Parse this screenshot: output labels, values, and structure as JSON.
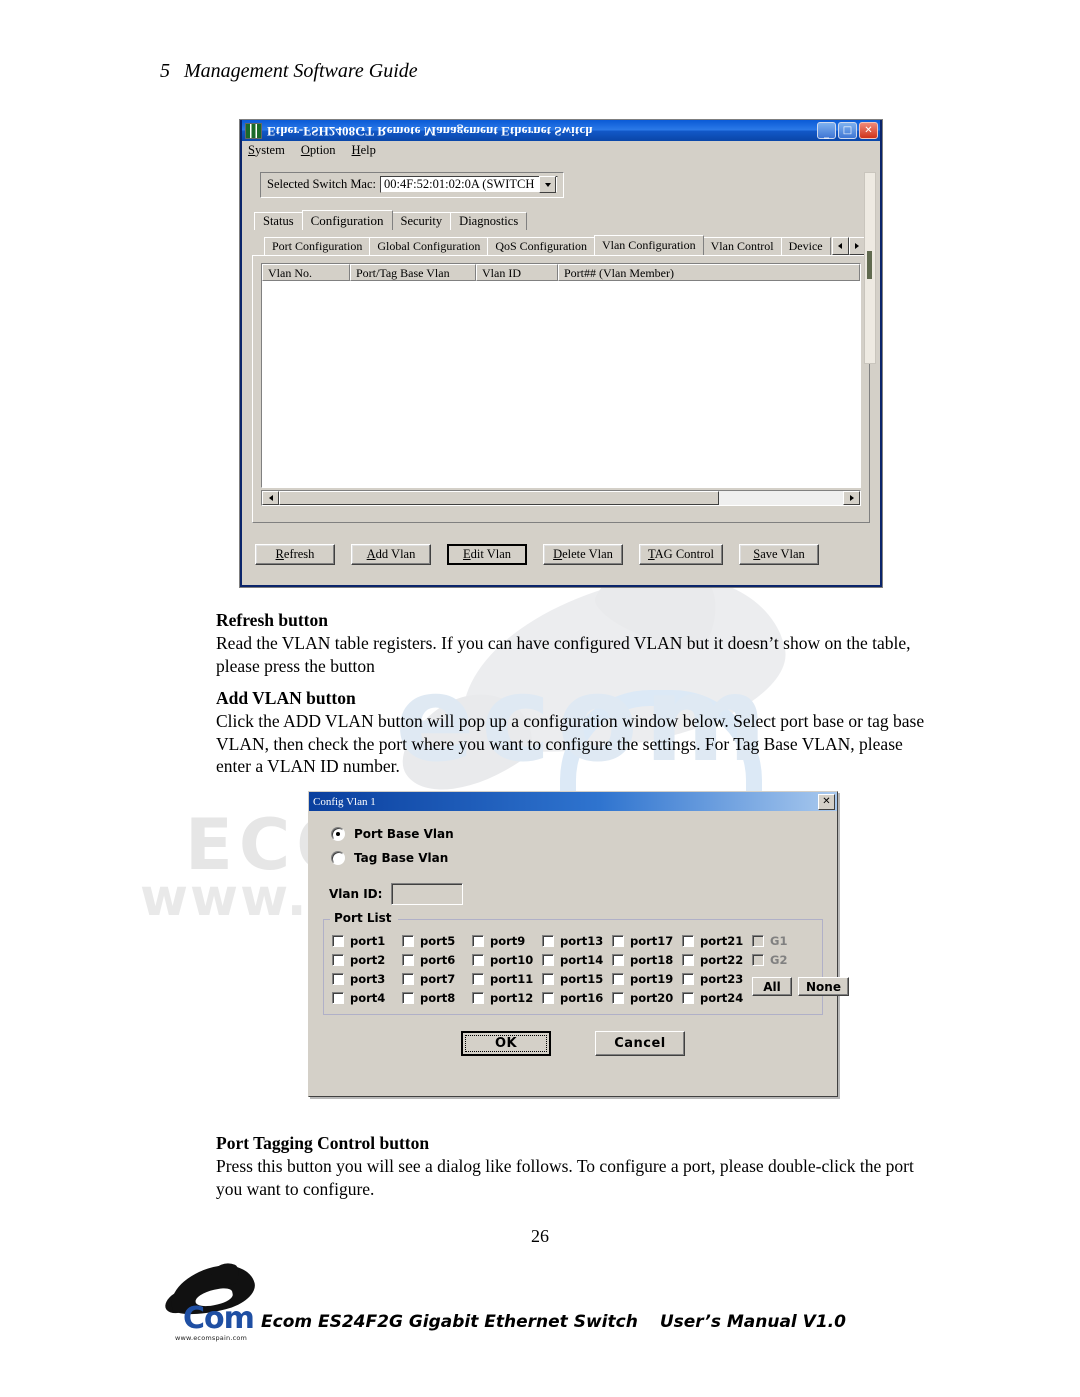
{
  "page": {
    "chapter_number": "5",
    "chapter_title": "Management Software Guide",
    "page_number": "26"
  },
  "app_window": {
    "title": "Ether-FSH2408GT Remote Management Ethernet Switch",
    "icon": "switch-icon",
    "window_buttons": {
      "minimize": "_",
      "maximize": "□",
      "close": "✕"
    },
    "menu": [
      "System",
      "Option",
      "Help"
    ],
    "mac_selector": {
      "label": "Selected Switch Mac:",
      "value": "00:4F:52:01:02:0A (SWITCH"
    },
    "tabs": [
      {
        "label": "Status",
        "active": false
      },
      {
        "label": "Configuration",
        "active": true
      },
      {
        "label": "Security",
        "active": false
      },
      {
        "label": "Diagnostics",
        "active": false
      }
    ],
    "subtabs": [
      {
        "label": "Port Configuration",
        "active": false
      },
      {
        "label": "Global Configuration",
        "active": false
      },
      {
        "label": "QoS Configuration",
        "active": false
      },
      {
        "label": "Vlan Configuration",
        "active": true
      },
      {
        "label": "Vlan Control",
        "active": false
      },
      {
        "label": "Device",
        "active": false
      }
    ],
    "table": {
      "columns": [
        "Vlan No.",
        "Port/Tag Base Vlan",
        "Vlan ID",
        "Port## (Vlan Member)"
      ],
      "rows": []
    },
    "buttons": [
      {
        "label": "Refresh",
        "default": false
      },
      {
        "label": "Add Vlan",
        "default": false
      },
      {
        "label": "Edit Vlan",
        "default": true
      },
      {
        "label": "Delete Vlan",
        "default": false
      },
      {
        "label": "TAG Control",
        "default": false
      },
      {
        "label": "Save Vlan",
        "default": false
      }
    ]
  },
  "dialog": {
    "title": "Config Vlan 1",
    "close_label": "✕",
    "radios": [
      {
        "label": "Port Base Vlan",
        "selected": true
      },
      {
        "label": "Tag Base Vlan",
        "selected": false
      }
    ],
    "vlan_id": {
      "label": "Vlan ID:",
      "value": ""
    },
    "port_list": {
      "legend": "Port List",
      "columns": [
        [
          "port1",
          "port2",
          "port3",
          "port4"
        ],
        [
          "port5",
          "port6",
          "port7",
          "port8"
        ],
        [
          "port9",
          "port10",
          "port11",
          "port12"
        ],
        [
          "port13",
          "port14",
          "port15",
          "port16"
        ],
        [
          "port17",
          "port18",
          "port19",
          "port20"
        ],
        [
          "port21",
          "port22",
          "port23",
          "port24"
        ],
        [
          "G1",
          "G2"
        ]
      ],
      "select_all_label": "All",
      "select_none_label": "None"
    },
    "ok_label": "OK",
    "cancel_label": "Cancel"
  },
  "sections": [
    {
      "title": "Refresh button",
      "body": "Read the VLAN table registers.  If you can have configured VLAN but it doesn’t show on the table, please press the button"
    },
    {
      "title": "Add VLAN button",
      "body": "Click the ADD VLAN button will pop up a configuration window below.  Select port base or tag base VLAN, then check the port where you want to configure the settings.  For Tag Base VLAN, please enter a VLAN ID number."
    },
    {
      "title": "Port Tagging Control button",
      "body": "Press this button you will see a dialog like follows. To configure a port, please double-click the port you want to configure."
    }
  ],
  "footer": {
    "logo_text": "Com",
    "logo_url": "www.ecomspain.com",
    "product": "Ecom ES24F2G Gigabit Ethernet Switch",
    "manual": "User’s Manual V1.0"
  },
  "watermark": {
    "brand": "ecom",
    "eco": "ECO",
    "www": "www.ecom"
  }
}
